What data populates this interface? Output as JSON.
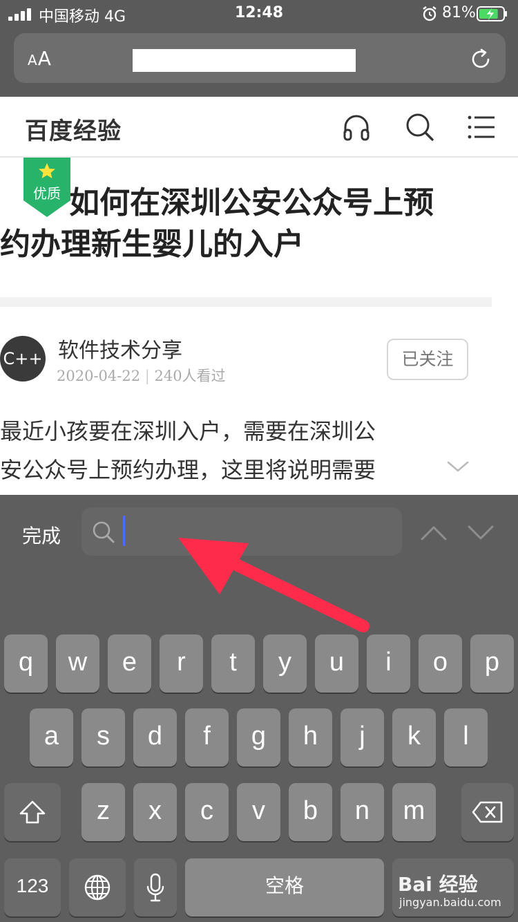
{
  "status_bar": {
    "carrier": "中国移动  4G",
    "time": "12:48",
    "battery_percent": "81%",
    "battery_level": 0.81,
    "icons": [
      "signal-icon",
      "alarm-icon",
      "battery-charging-icon"
    ]
  },
  "browser": {
    "text_size_button": "AA",
    "url": "",
    "reload_icon": "reload-icon"
  },
  "header": {
    "site_name": "百度经验",
    "icons": [
      "headphones-icon",
      "search-icon",
      "menu-icon"
    ]
  },
  "article": {
    "badge_label": "优质",
    "title_line1": "如何在深圳公安公众号上预",
    "title_line2": "约办理新生婴儿的入户",
    "author_avatar": "C++",
    "author_name": "软件技术分享",
    "date": "2020-04-22",
    "views": "240人看过",
    "follow_label": "已关注",
    "intro_line1": "最近小孩要在深圳入户，需要在深圳公",
    "intro_line2": "安公众号上预约办理，这里将说明需要"
  },
  "find_bar": {
    "done_label": "完成",
    "search_value": "",
    "prev_icon": "chevron-up-icon",
    "next_icon": "chevron-down-icon"
  },
  "keyboard": {
    "row1": [
      "q",
      "w",
      "e",
      "r",
      "t",
      "y",
      "u",
      "i",
      "o",
      "p"
    ],
    "row2": [
      "a",
      "s",
      "d",
      "f",
      "g",
      "h",
      "j",
      "k",
      "l"
    ],
    "row3": [
      "z",
      "x",
      "c",
      "v",
      "b",
      "n",
      "m"
    ],
    "numbers_label": "123",
    "space_label": "空格",
    "special_icons": [
      "shift-icon",
      "backspace-icon",
      "globe-icon",
      "microphone-icon"
    ]
  },
  "watermark": {
    "logo": "Bai 经验",
    "url": "jingyan.baidu.com"
  },
  "colors": {
    "badge_green": "#27b36a",
    "annotation_red": "#ff2b4a",
    "caret_blue": "#4a6cff"
  }
}
